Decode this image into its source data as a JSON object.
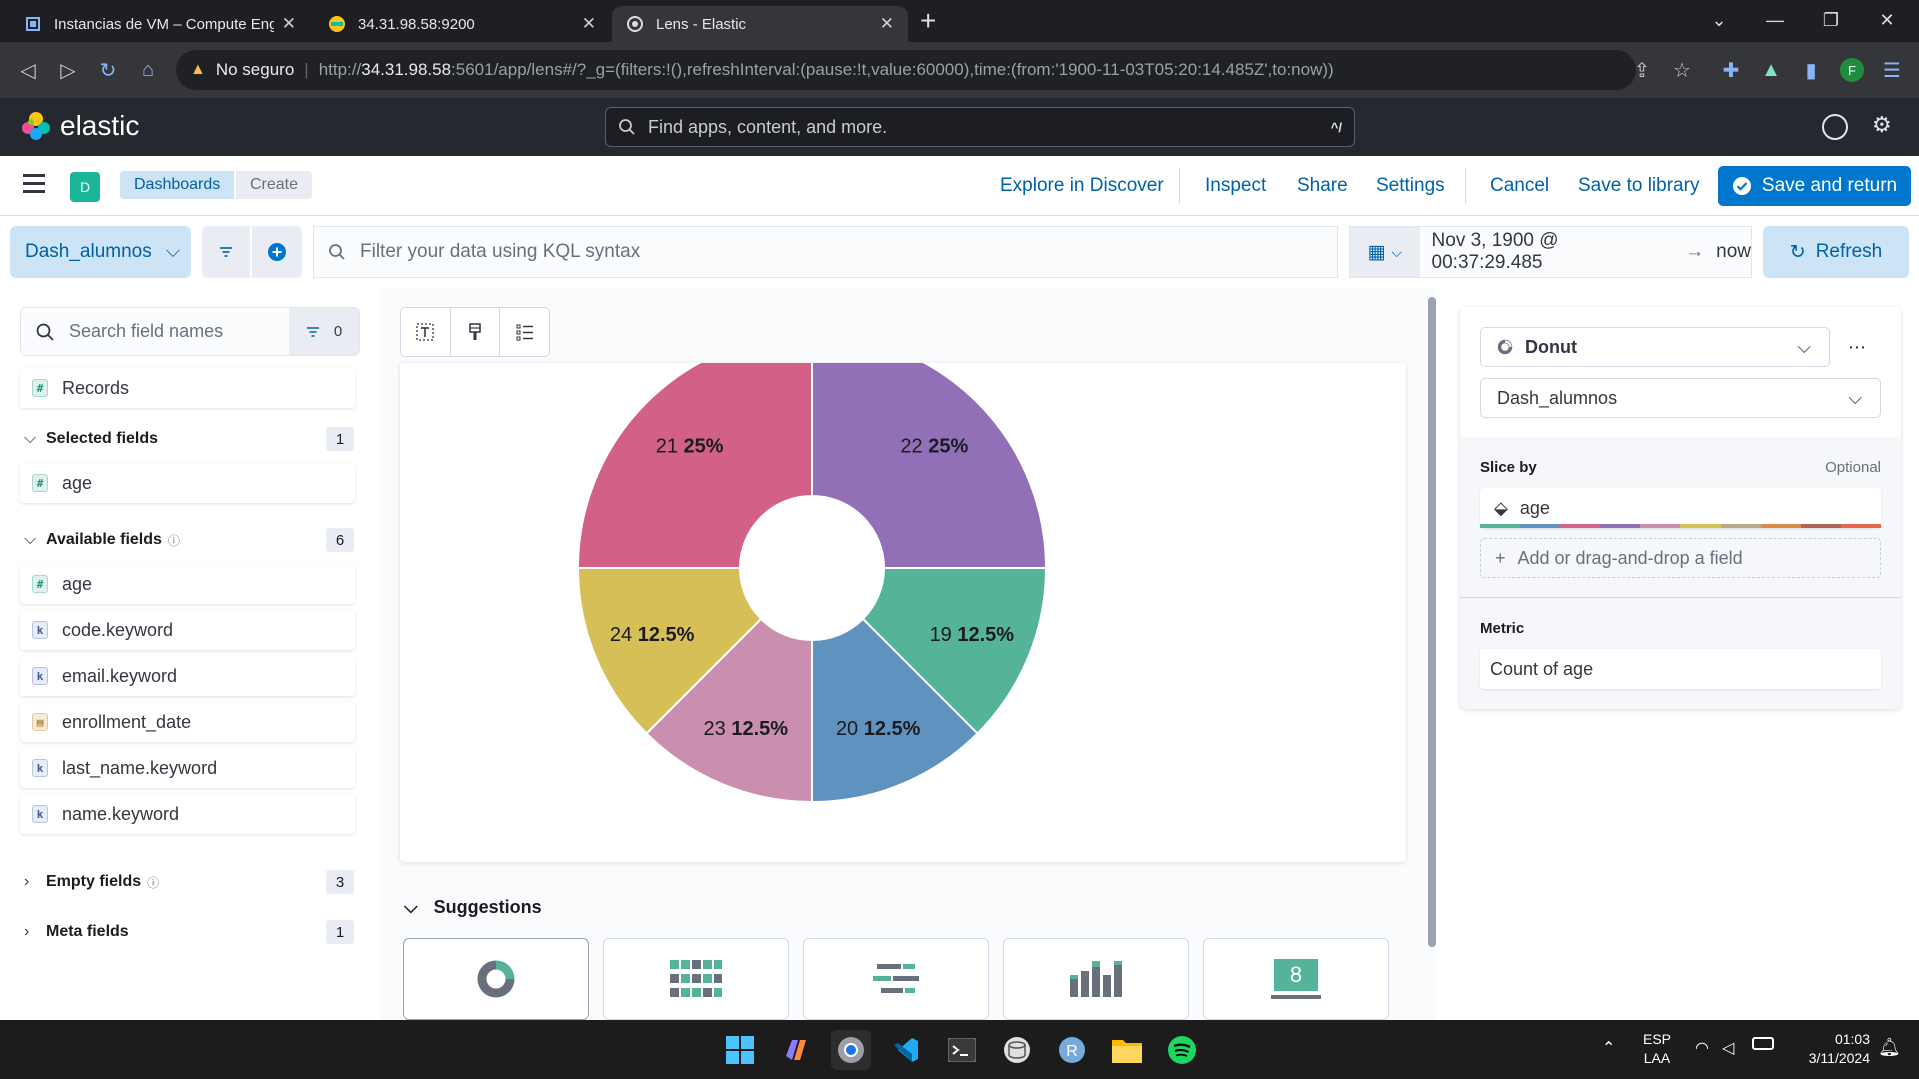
{
  "browser": {
    "tabs": [
      {
        "title": "Instancias de VM – Compute Engine",
        "active": false
      },
      {
        "title": "34.31.98.58:9200",
        "active": false
      },
      {
        "title": "Lens - Elastic",
        "active": true
      }
    ],
    "security_label": "No seguro",
    "url_host": "http://34.31.98.58",
    "url_host_bold": "34.31.98.58",
    "url_prefix": "http://",
    "url_rest": ":5601/app/lens#/?_g=(filters:!(),refreshInterval:(pause:!t,value:60000),time:(from:'1900-11-03T05:20:14.485Z',to:now))",
    "profile_initial": "F"
  },
  "kibana": {
    "brand": "elastic",
    "search_placeholder": "Find apps, content, and more.",
    "search_shortcut": "^/",
    "space_initial": "D",
    "breadcrumbs": [
      "Dashboards",
      "Create"
    ],
    "header_links": [
      "Explore in Discover",
      "Inspect",
      "Share",
      "Settings",
      "Cancel",
      "Save to library"
    ],
    "save_button": "Save and return"
  },
  "query": {
    "data_view": "Dash_alumnos",
    "kql_placeholder": "Filter your data using KQL syntax",
    "time_from": "Nov 3, 1900 @ 00:37:29.485",
    "time_to": "now",
    "refresh_label": "Refresh"
  },
  "fields_panel": {
    "search_placeholder": "Search field names",
    "filter_count": "0",
    "records": "Records",
    "selected": {
      "label": "Selected fields",
      "count": "1",
      "items": [
        "age"
      ]
    },
    "available": {
      "label": "Available fields",
      "count": "6",
      "items": [
        "age",
        "code.keyword",
        "email.keyword",
        "enrollment_date",
        "last_name.keyword",
        "name.keyword"
      ]
    },
    "empty": {
      "label": "Empty fields",
      "count": "3"
    },
    "meta": {
      "label": "Meta fields",
      "count": "1"
    }
  },
  "chart_data": {
    "type": "pie",
    "variant": "donut",
    "title": "",
    "slices": [
      {
        "label": "22",
        "percent": "25%",
        "value": 25,
        "color": "#9170b8"
      },
      {
        "label": "19",
        "percent": "12.5%",
        "value": 12.5,
        "color": "#54b399"
      },
      {
        "label": "20",
        "percent": "12.5%",
        "value": 12.5,
        "color": "#6092c0"
      },
      {
        "label": "23",
        "percent": "12.5%",
        "value": 12.5,
        "color": "#ca8eae"
      },
      {
        "label": "24",
        "percent": "12.5%",
        "value": 12.5,
        "color": "#d6bf57"
      },
      {
        "label": "21",
        "percent": "25%",
        "value": 25,
        "color": "#d36086"
      }
    ]
  },
  "suggestions": {
    "label": "Suggestions",
    "items": [
      "donut-icon",
      "heatmap-icon",
      "bar-horizontal-icon",
      "bar-vertical-icon",
      "metric-icon"
    ],
    "metric_value": "8"
  },
  "config_panel": {
    "chart_type": "Donut",
    "data_view": "Dash_alumnos",
    "slice_by_label": "Slice by",
    "optional_label": "Optional",
    "slice_field": "age",
    "add_field_placeholder": "Add or drag-and-drop a field",
    "metric_label": "Metric",
    "metric_value": "Count of age"
  },
  "taskbar": {
    "lang": "ESP",
    "layout": "LAA",
    "time": "01:03",
    "date": "3/11/2024"
  }
}
